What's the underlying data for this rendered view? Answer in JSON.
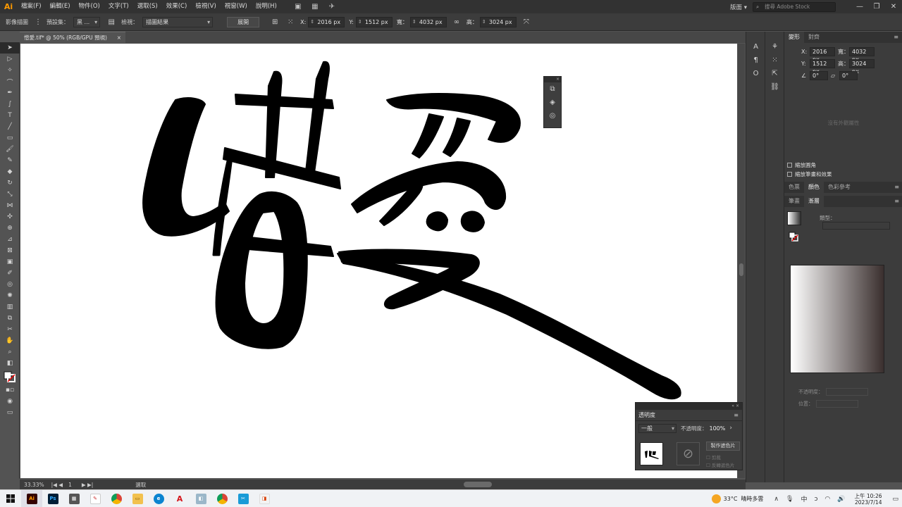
{
  "app": {
    "logo": "Ai",
    "menus": [
      "檔案(F)",
      "編輯(E)",
      "物件(O)",
      "文字(T)",
      "選取(S)",
      "效果(C)",
      "檢視(V)",
      "視窗(W)",
      "說明(H)"
    ],
    "workspace": "版面",
    "stock_search_placeholder": "搜尋 Adobe Stock"
  },
  "control_bar": {
    "label_image_trace": "影像描圖",
    "label_preset": "預設集：",
    "preset_value": "黑 ...",
    "label_view": "檢視：",
    "view_value": "描圖結果",
    "expand_button": "展開",
    "x_label": "X:",
    "x_value": "2016 px",
    "y_label": "Y:",
    "y_value": "1512 px",
    "w_label": "寬：",
    "w_value": "4032 px",
    "h_label": "高：",
    "h_value": "3024 px"
  },
  "document": {
    "tab_title": "憎愛.tif* @ 50% (RGB/GPU 預視)",
    "tab_close": "×"
  },
  "status_bar": {
    "zoom": "33.33%",
    "artboard": "1",
    "mode": "選取"
  },
  "transparency_panel": {
    "title": "透明度",
    "blend_mode": "一般",
    "opacity_label": "不透明度：",
    "opacity_value": "100%",
    "make_mask_button": "製作遮色片",
    "clip_label": "剪裁",
    "invert_label": "反轉遮色片"
  },
  "transform_panel": {
    "tab_transform": "變形",
    "tab_align": "對齊",
    "x_label": "X:",
    "x_value": "2016 px",
    "w_label": "寬：",
    "w_value": "4032 px",
    "y_label": "Y:",
    "y_value": "1512 px",
    "h_label": "高：",
    "h_value": "3024 px",
    "angle_value": "0°",
    "shear_value": "0°",
    "no_appearance": "沒有外觀屬性",
    "scale_corners": "縮放圓角",
    "scale_strokes": "縮放筆畫和效果"
  },
  "color_panel": {
    "tab_appearance": "色票",
    "tab_color": "顏色",
    "tab_guide": "色彩參考",
    "tab_stroke": "筆畫",
    "tab_gradient": "漸層",
    "type_label": "類型：",
    "opacity_label": "不透明度：",
    "position_label": "位置："
  },
  "taskbar": {
    "temperature": "33°C",
    "weather": "晴時多雲",
    "ime": "中",
    "time": "上午 10:26",
    "date": "2023/7/14"
  },
  "colors": {
    "accent_ai": "#ff9a00",
    "panel_bg": "#3c3c3c",
    "workspace_bg": "#535353",
    "ink": "#000000"
  }
}
